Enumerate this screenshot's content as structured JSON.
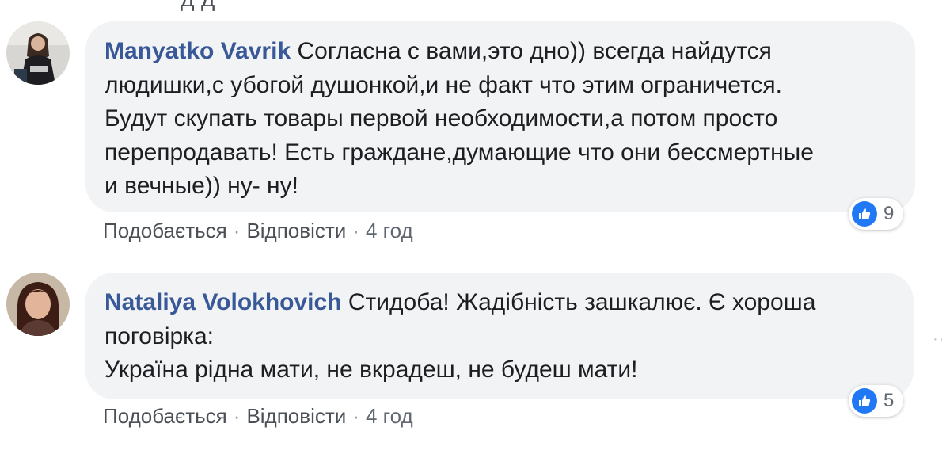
{
  "colors": {
    "author": "#385898",
    "bubble": "#f2f3f5",
    "like": "#2078f4",
    "meta": "#606770"
  },
  "cut_off_text": "д д",
  "comments": [
    {
      "author": "Manyatko Vavrik",
      "text": "Согласна с вами,это дно)) всегда найдутся\nлюдишки,с убогой душонкой,и не факт что этим ограничется.\nБудут скупать товары первой необходимости,а потом просто\nперепродавать! Есть граждане,думающие что они бессмертные\nи вечные)) ну- ну!",
      "reaction_icon": "like-icon",
      "reaction_count": "9",
      "like_label": "Подобається",
      "reply_label": "Відповісти",
      "separator": "·",
      "time": "4 год"
    },
    {
      "author": "Nataliya Volokhovich",
      "text": "Стидоба! Жадібність зашкалює. Є хороша\nпоговірка:\nУкраїна рідна мати, не вкрадеш, не будеш мати!",
      "reaction_icon": "like-icon",
      "reaction_count": "5",
      "like_label": "Подобається",
      "reply_label": "Відповісти",
      "separator": "·",
      "time": "4 год"
    }
  ]
}
